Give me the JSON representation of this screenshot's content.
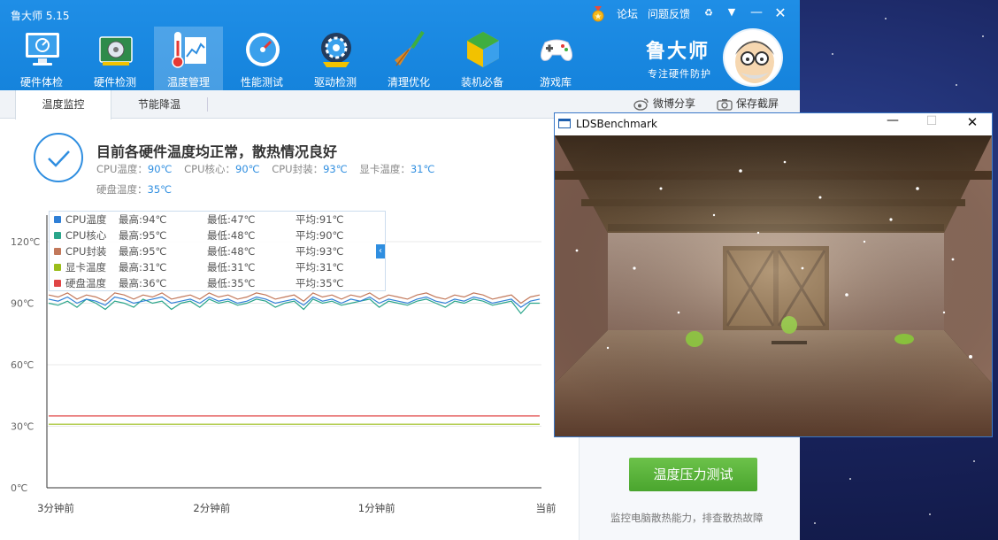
{
  "app": {
    "title": "鲁大师 5.15",
    "forum": "论坛",
    "feedback": "问题反馈",
    "brand_name": "鲁大师",
    "brand_slogan": "专注硬件防护"
  },
  "nav": [
    {
      "label": "硬件体检",
      "icon": "monitor-icon"
    },
    {
      "label": "硬件检测",
      "icon": "circuit-board-icon"
    },
    {
      "label": "温度管理",
      "icon": "thermometer-icon"
    },
    {
      "label": "性能测试",
      "icon": "speedometer-icon"
    },
    {
      "label": "驱动检测",
      "icon": "gear-icon"
    },
    {
      "label": "清理优化",
      "icon": "broom-icon"
    },
    {
      "label": "装机必备",
      "icon": "box-icon"
    },
    {
      "label": "游戏库",
      "icon": "gamepad-icon"
    }
  ],
  "active_nav": "温度管理",
  "tabs": [
    {
      "label": "温度监控"
    },
    {
      "label": "节能降温"
    }
  ],
  "share": {
    "weibo": "微博分享",
    "screenshot": "保存截屏"
  },
  "status": {
    "title": "目前各硬件温度均正常，散热情况良好",
    "items": [
      {
        "label": "CPU温度：",
        "value": "90℃"
      },
      {
        "label": "CPU核心：",
        "value": "90℃"
      },
      {
        "label": "CPU封装：",
        "value": "93℃"
      },
      {
        "label": "显卡温度：",
        "value": "31℃"
      },
      {
        "label": "硬盘温度：",
        "value": "35℃"
      }
    ]
  },
  "legend": [
    {
      "name": "CPU温度",
      "max": "最高:94℃",
      "min": "最低:47℃",
      "avg": "平均:91℃",
      "color": "#2f7fd6"
    },
    {
      "name": "CPU核心",
      "max": "最高:95℃",
      "min": "最低:48℃",
      "avg": "平均:90℃",
      "color": "#2aa58a"
    },
    {
      "name": "CPU封装",
      "max": "最高:95℃",
      "min": "最低:48℃",
      "avg": "平均:93℃",
      "color": "#c2785a"
    },
    {
      "name": "显卡温度",
      "max": "最高:31℃",
      "min": "最低:31℃",
      "avg": "平均:31℃",
      "color": "#9bbd1a"
    },
    {
      "name": "硬盘温度",
      "max": "最高:36℃",
      "min": "最低:35℃",
      "avg": "平均:35℃",
      "color": "#e04545"
    }
  ],
  "chart_data": {
    "type": "line",
    "y_ticks": [
      "120℃",
      "90℃",
      "60℃",
      "30℃",
      "0℃"
    ],
    "x_ticks": [
      "3分钟前",
      "2分钟前",
      "1分钟前",
      "当前"
    ],
    "ylim": [
      0,
      120
    ],
    "grid": true,
    "series": [
      {
        "name": "CPU温度",
        "color": "#2f7fd6",
        "values": [
          92,
          91,
          93,
          90,
          92,
          91,
          89,
          93,
          92,
          90,
          91,
          92,
          93,
          90,
          91,
          92,
          90,
          93,
          91,
          92,
          90,
          91,
          93,
          92,
          90,
          91,
          92,
          89,
          93,
          91,
          92,
          90,
          92,
          91,
          93,
          90,
          92,
          91,
          90,
          92,
          93,
          91,
          90,
          92,
          91,
          93,
          92,
          90,
          91,
          92,
          88,
          91,
          92
        ]
      },
      {
        "name": "CPU核心",
        "color": "#2aa58a",
        "values": [
          90,
          89,
          91,
          88,
          92,
          90,
          87,
          91,
          90,
          88,
          92,
          90,
          91,
          87,
          90,
          91,
          88,
          92,
          90,
          91,
          89,
          90,
          92,
          91,
          88,
          90,
          91,
          87,
          92,
          90,
          91,
          89,
          90,
          91,
          92,
          88,
          91,
          90,
          89,
          91,
          92,
          90,
          88,
          91,
          90,
          92,
          91,
          89,
          90,
          91,
          85,
          90,
          90
        ]
      },
      {
        "name": "CPU封装",
        "color": "#c2785a",
        "values": [
          94,
          93,
          95,
          92,
          94,
          93,
          91,
          95,
          94,
          92,
          94,
          93,
          95,
          92,
          93,
          94,
          92,
          95,
          93,
          94,
          92,
          93,
          95,
          94,
          92,
          93,
          94,
          91,
          95,
          93,
          94,
          92,
          94,
          93,
          95,
          92,
          94,
          93,
          92,
          94,
          95,
          93,
          92,
          94,
          93,
          95,
          94,
          92,
          93,
          94,
          90,
          93,
          94
        ]
      },
      {
        "name": "显卡温度",
        "color": "#9bbd1a",
        "values": [
          31,
          31,
          31,
          31,
          31,
          31,
          31,
          31,
          31,
          31,
          31,
          31,
          31,
          31,
          31,
          31,
          31,
          31,
          31,
          31,
          31,
          31,
          31,
          31,
          31,
          31,
          31,
          31,
          31,
          31,
          31,
          31,
          31,
          31,
          31,
          31,
          31,
          31,
          31,
          31,
          31,
          31,
          31,
          31,
          31,
          31,
          31,
          31,
          31,
          31,
          31,
          31,
          31
        ]
      },
      {
        "name": "硬盘温度",
        "color": "#e04545",
        "values": [
          35,
          35,
          35,
          35,
          35,
          35,
          35,
          35,
          35,
          35,
          35,
          35,
          35,
          35,
          35,
          35,
          35,
          35,
          35,
          35,
          35,
          35,
          35,
          35,
          35,
          35,
          35,
          35,
          35,
          35,
          35,
          35,
          35,
          35,
          35,
          35,
          35,
          35,
          35,
          35,
          35,
          35,
          35,
          35,
          35,
          35,
          35,
          35,
          35,
          35,
          35,
          35,
          35
        ]
      }
    ]
  },
  "stress": {
    "button": "温度压力测试",
    "desc": "监控电脑散热能力，排查散热故障"
  },
  "bench": {
    "title": "LDSBenchmark"
  }
}
